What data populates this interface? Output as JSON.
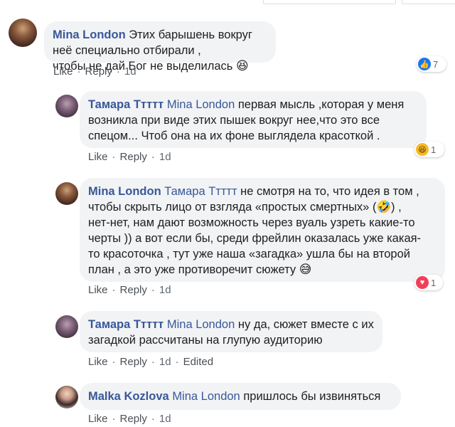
{
  "actions": {
    "like": "Like",
    "reply": "Reply",
    "edited": "Edited"
  },
  "comments": [
    {
      "author": "Mina London",
      "mention": "",
      "text_line1": "Этих барышень вокруг неё специально отбирали ,",
      "text_line2": "чтобы не дай Бог не выделилась",
      "emoji": "😆",
      "time": "1d",
      "reaction": {
        "icon": "like-icon",
        "count": "7"
      }
    },
    {
      "author": "Тамара Ттттт",
      "mention": "Mina London",
      "text_line1": "первая мысль ,которая у меня",
      "text_line2": "возникла при виде этих пышек вокруг нее,что это все",
      "text_line3": "спецом... Чтоб она на их фоне выглядела красоткой .",
      "time": "1d",
      "reaction": {
        "icon": "haha-icon",
        "count": "1"
      }
    },
    {
      "author": "Mina London",
      "mention": "Тамара Ттттт",
      "text_line1": "не смотря на то, что идея в том ,",
      "text_line2": "чтобы скрыть лицо от взгляда «простых смертных» (🤣) ,",
      "text_line3": "нет-нет, нам дают возможность через вуаль узреть какие-то",
      "text_line4": "черты )) а вот если бы, среди фрейлин оказалась уже какая-",
      "text_line5": "то красоточка , тут уже наша «загадка» ушла бы на второй",
      "text_line6": "план , а это уже противоречит сюжету",
      "emoji": "😅",
      "time": "1d",
      "reaction": {
        "icon": "love-icon",
        "count": "1"
      }
    },
    {
      "author": "Тамара Ттттт",
      "mention": "Mina London",
      "text_line1": "ну да, сюжет вместе с их",
      "text_line2": "загадкой рассчитаны на глупую аудиторию",
      "time": "1d"
    },
    {
      "author": "Malka Kozlova",
      "mention": "Mina London",
      "text_line1": "пришлось бы извиняться",
      "time": "1d"
    }
  ]
}
